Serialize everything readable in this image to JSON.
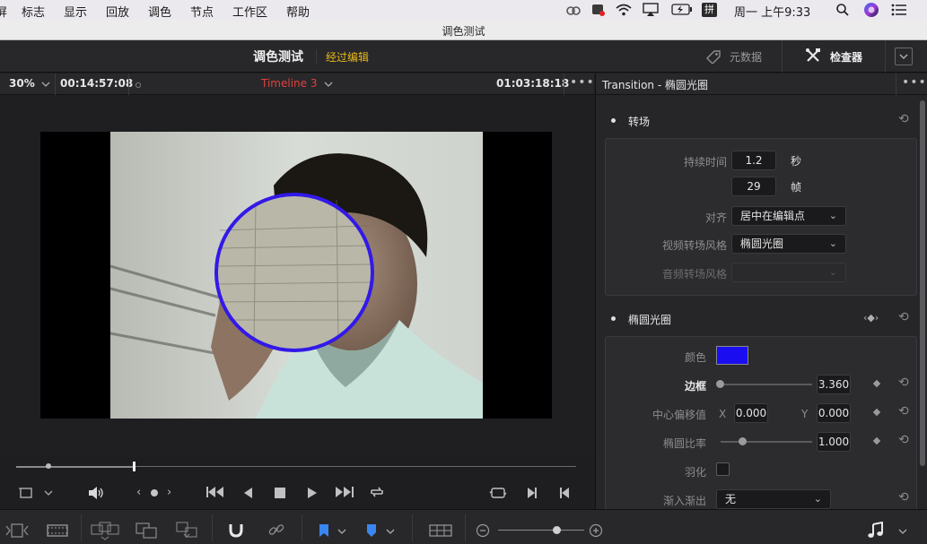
{
  "menubar": {
    "items": [
      "屏",
      "标志",
      "显示",
      "回放",
      "调色",
      "节点",
      "工作区",
      "帮助"
    ],
    "status_icons": [
      "creative-cloud-icon",
      "record-icon",
      "wifi-icon",
      "airplay-icon",
      "battery-icon",
      "input-method-icon"
    ],
    "input_method": "拼",
    "clock": "周一 上午9:33"
  },
  "window": {
    "title": "调色测试"
  },
  "page_header": {
    "project": "调色测试",
    "mode": "经过编辑",
    "metadata_label": "元数据",
    "inspector_label": "检查器"
  },
  "viewer": {
    "zoom": "30%",
    "source_timecode": "00:14:57:08",
    "timeline_name": "Timeline 3",
    "record_timecode": "01:03:18:18",
    "overlay_color": "#3219e8",
    "playhead_fraction": 0.21
  },
  "inspector": {
    "title": "Transition - 椭圆光圈",
    "transition_section": {
      "title": "转场",
      "duration_label": "持续时间",
      "duration_seconds": "1.2",
      "seconds_unit": "秒",
      "duration_frames": "29",
      "frames_unit": "帧",
      "alignment_label": "对齐",
      "alignment_value": "居中在编辑点",
      "video_style_label": "视频转场风格",
      "video_style_value": "椭圆光圈",
      "audio_style_label": "音频转场风格",
      "audio_style_value": ""
    },
    "iris_section": {
      "title": "椭圆光圈",
      "color_label": "颜色",
      "color_value": "#1a0ef0",
      "border_label": "边框",
      "border_value": "3.360",
      "border_fraction": 0.0,
      "center_offset_label": "中心偏移值",
      "x_label": "X",
      "x_value": "0.000",
      "y_label": "Y",
      "y_value": "0.000",
      "aspect_label": "椭圆比率",
      "aspect_value": "1.000",
      "aspect_fraction": 0.25,
      "feather_label": "羽化",
      "ease_label": "渐入渐出",
      "ease_value": "无"
    }
  },
  "bottombar": {
    "icons": [
      "clips-icon",
      "filmstrip-icon",
      "multi-screen-icon",
      "dual-screen-icon",
      "sync-screen-icon",
      "snap-magnet-icon",
      "link-icon",
      "blue-flag-icon",
      "blue-marker-icon",
      "timeline-view-icon",
      "zoom-out-icon",
      "zoom-in-icon",
      "music-note-icon"
    ],
    "zoom_fraction": 0.75
  }
}
